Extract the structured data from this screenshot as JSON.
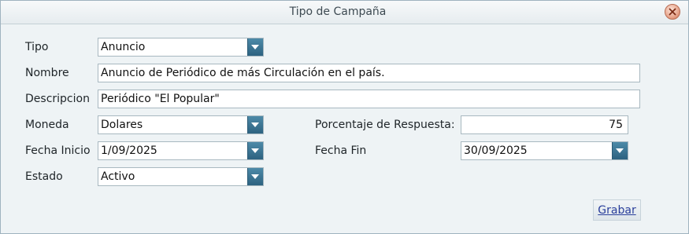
{
  "window": {
    "title": "Tipo de Campaña"
  },
  "form": {
    "tipo": {
      "label": "Tipo",
      "value": "Anuncio"
    },
    "nombre": {
      "label": "Nombre",
      "value": "Anuncio de Periódico de más Circulación en el país."
    },
    "descripcion": {
      "label": "Descripcion",
      "value": "Periódico \"El Popular\""
    },
    "moneda": {
      "label": "Moneda",
      "value": "Dolares"
    },
    "porcentaje": {
      "label": "Porcentaje de Respuesta:",
      "value": "75"
    },
    "fecha_inicio": {
      "label": "Fecha Inicio",
      "value": "1/09/2025"
    },
    "fecha_fin": {
      "label": "Fecha Fin",
      "value": "30/09/2025"
    },
    "estado": {
      "label": "Estado",
      "value": "Activo"
    }
  },
  "actions": {
    "save_label": "Grabar"
  },
  "icons": {
    "close": "close-icon",
    "dropdown": "chevron-down-icon"
  },
  "colors": {
    "accent": "#3a7594",
    "link": "#2b3f9c"
  }
}
